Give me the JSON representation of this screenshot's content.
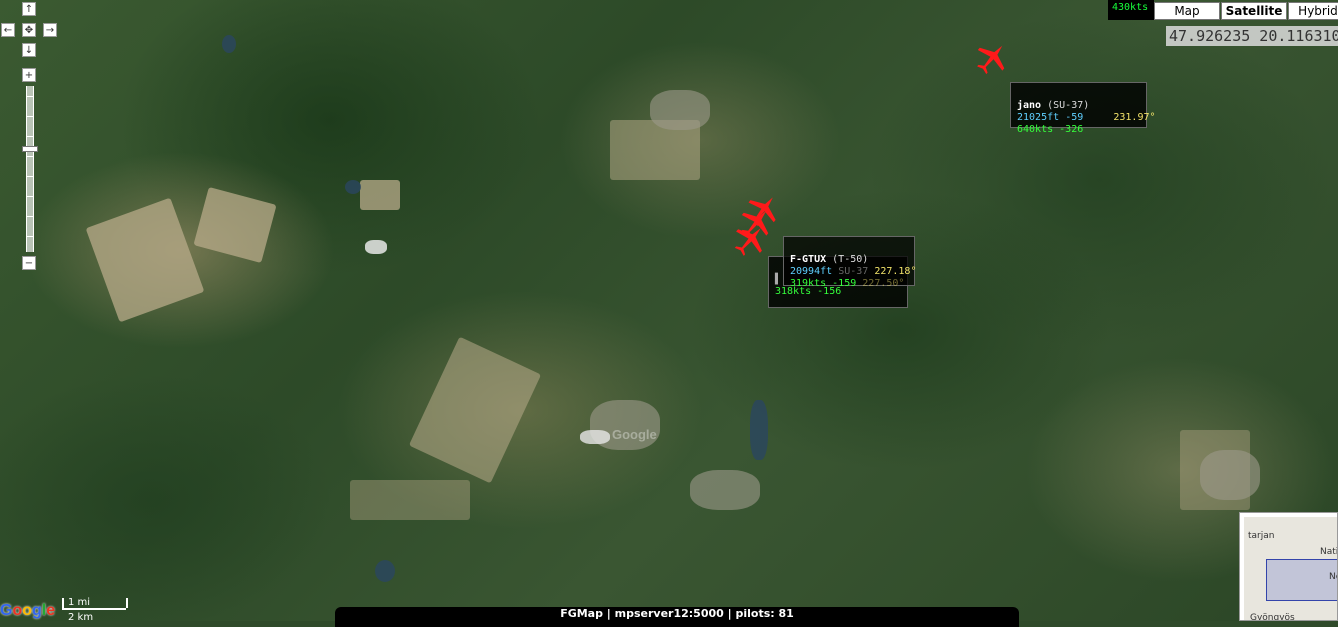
{
  "map": {
    "coordinates": "47.926235 20.116310",
    "map_types": [
      "Map",
      "Satellite",
      "Hybrid"
    ],
    "active_map_type": "Satellite",
    "scale": {
      "imperial": "1 mi",
      "metric": "2 km"
    },
    "logo": "Google",
    "watermark": "Google",
    "overview": {
      "labels": [
        "tarjan",
        "Natio",
        "Gyöngyös",
        "Ne"
      ]
    }
  },
  "top_stub": {
    "speed": "430kts"
  },
  "nav": {
    "up_icon": "↑",
    "down_icon": "↓",
    "left_icon": "←",
    "right_icon": "→",
    "center_icon": "✥",
    "zoom_in": "+",
    "zoom_out": "−"
  },
  "aircraft": [
    {
      "callsign": "jano",
      "model": "(SU-37)",
      "altitude": "21025ft",
      "vspeed": "-59",
      "heading": "231.97°",
      "speed": "640kts",
      "speed_change": "-326"
    },
    {
      "callsign": "F-GTUX",
      "model": "(T-50)",
      "altitude": "20994ft",
      "vspeed": "SU-37",
      "heading": "227.18°",
      "speed": "319kts",
      "speed_change": "-159"
    },
    {
      "ghost_heading": "227.50°",
      "ghost_speed": "318kts",
      "ghost_change": "-156"
    }
  ],
  "status_bar": {
    "text": "FGMap | mpserver12:5000 | pilots: 81"
  },
  "colors": {
    "plane": "#ff1a1a",
    "speed_text": "#35ff3c",
    "alt_text": "#5fd0ff",
    "heading_text": "#f2e36a"
  }
}
